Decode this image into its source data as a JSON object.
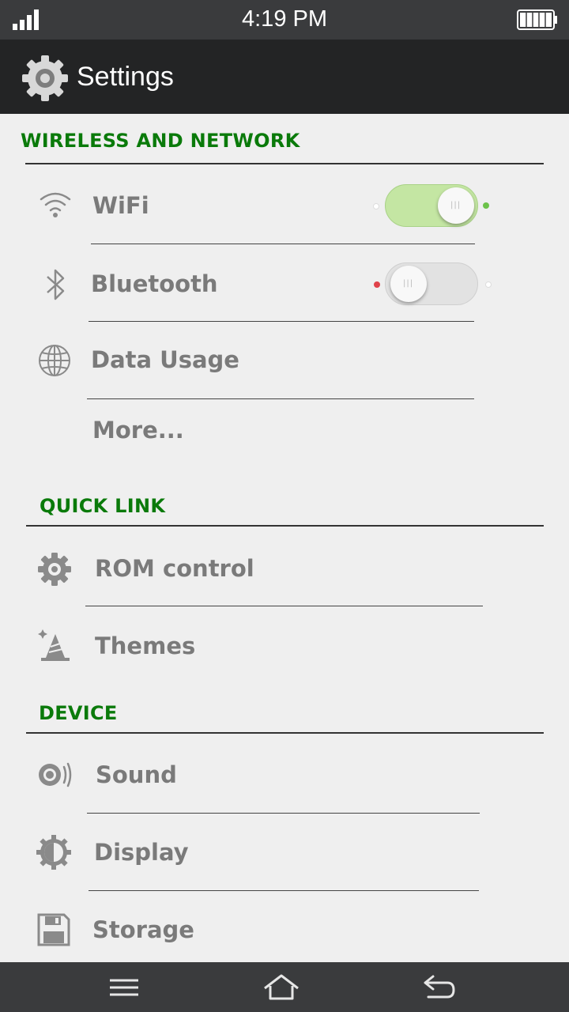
{
  "status_bar": {
    "time": "4:19 PM"
  },
  "action_bar": {
    "title": "Settings",
    "icon": "gear-icon"
  },
  "sections": {
    "wireless": {
      "header": "WIRELESS AND NETWORK",
      "wifi": {
        "label": "WiFi",
        "icon": "wifi-icon",
        "enabled": true
      },
      "bluetooth": {
        "label": "Bluetooth",
        "icon": "bluetooth-icon",
        "enabled": false
      },
      "data_usage": {
        "label": "Data Usage",
        "icon": "globe-icon"
      },
      "more": {
        "label": "More..."
      }
    },
    "quick_link": {
      "header": "QUICK LINK",
      "rom_control": {
        "label": "ROM control",
        "icon": "gear-icon"
      },
      "themes": {
        "label": "Themes",
        "icon": "themes-icon"
      }
    },
    "device": {
      "header": "DEVICE",
      "sound": {
        "label": "Sound",
        "icon": "speaker-icon"
      },
      "display": {
        "label": "Display",
        "icon": "brightness-icon"
      },
      "storage": {
        "label": "Storage",
        "icon": "floppy-disk-icon"
      }
    }
  },
  "nav_bar": {
    "menu": "menu-icon",
    "home": "home-icon",
    "back": "back-icon"
  },
  "colors": {
    "section_header": "#0a7a0a",
    "toggle_on": "#c4e6a3",
    "toggle_off": "#e2e2e2",
    "indicator_on": "#6cc24a",
    "indicator_off": "#e0424a"
  }
}
